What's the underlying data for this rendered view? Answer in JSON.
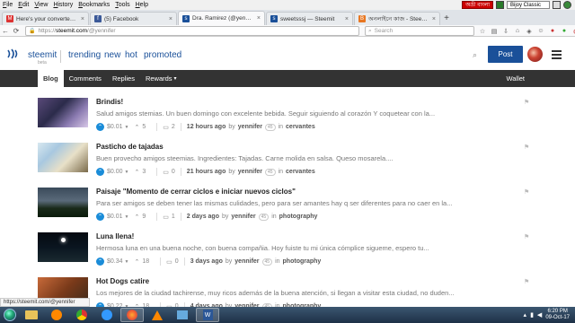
{
  "menubar": {
    "items": [
      {
        "label": "File",
        "u": "F",
        "rest": "ile"
      },
      {
        "label": "Edit",
        "u": "E",
        "rest": "dit"
      },
      {
        "label": "View",
        "u": "V",
        "rest": "iew"
      },
      {
        "label": "History",
        "u": "H",
        "rest": "istory"
      },
      {
        "label": "Bookmarks",
        "u": "B",
        "rest": "ookmarks"
      },
      {
        "label": "Tools",
        "u": "T",
        "rest": "ools"
      },
      {
        "label": "Help",
        "u": "H",
        "rest": "elp"
      }
    ],
    "lang_badge": "অভ্রী বাংলা",
    "keyboard": "Bijoy Classic"
  },
  "tabs": [
    {
      "title": "Here's your converted docu",
      "icon_color": "#d33",
      "icon": "M"
    },
    {
      "title": "(5) Facebook",
      "icon_color": "#3b5998",
      "icon": "f"
    },
    {
      "title": "Dra. Ramirez (@yennifer) —",
      "icon_color": "#1a5099",
      "icon": "s"
    },
    {
      "title": "sweetsssj — Steemit",
      "icon_color": "#1a5099",
      "icon": "s"
    },
    {
      "title": "অনলাইনে কাজ - Steemit Lovers",
      "icon_color": "#e87722",
      "icon": "B"
    }
  ],
  "navbar": {
    "url_prefix": "https://",
    "url_host": "steemit.com",
    "url_path": "/@yennifer",
    "search_placeholder": "Search"
  },
  "header": {
    "brand": "steemit",
    "brand_sub": "beta",
    "nav": [
      "trending",
      "new",
      "hot",
      "promoted"
    ],
    "post_label": "Post"
  },
  "usernav": {
    "items": [
      "Blog",
      "Comments",
      "Replies",
      "Rewards"
    ],
    "rewards_caret": "▾",
    "wallet": "Wallet"
  },
  "posts": [
    {
      "title": "Brindis!",
      "body": "Salud amigos stemias. Un buen domingo con excelente bebida. Seguir siguiendo al corazón Y coquetear con la...",
      "payout": "$0.01",
      "votes": "5",
      "comments": "2",
      "time": "12 hours ago",
      "author": "yennifer",
      "rep": "45",
      "category": "cervantes"
    },
    {
      "title": "Pasticho de tajadas",
      "body": "Buen provecho amigos steemias. Ingredientes: Tajadas. Carne molida en salsa. Queso mosarela....",
      "payout": "$0.00",
      "votes": "3",
      "comments": "0",
      "time": "21 hours ago",
      "author": "yennifer",
      "rep": "45",
      "category": "cervantes"
    },
    {
      "title": "Paisaje \"Momento de cerrar ciclos e iniciar nuevos ciclos\"",
      "body": "Para ser amigos se deben tener las mismas culidades, pero para ser amantes hay q ser diferentes para no caer en la...",
      "payout": "$0.01",
      "votes": "9",
      "comments": "1",
      "time": "2 days ago",
      "author": "yennifer",
      "rep": "45",
      "category": "photography"
    },
    {
      "title": "Luna llena!",
      "body": "Hermosa luna en una buena noche, con buena compañia. Hoy fuiste tu mi única cómplice sigueme, espero tu...",
      "payout": "$0.34",
      "votes": "18",
      "comments": "0",
      "time": "3 days ago",
      "author": "yennifer",
      "rep": "45",
      "category": "photography"
    },
    {
      "title": "Hot Dogs catire",
      "body": "Los mejores de la ciudad tachirense, muy ricos además de la buena atención, si llegan a visitar esta ciudad, no duden...",
      "payout": "$0.22",
      "votes": "18",
      "comments": "0",
      "time": "4 days ago",
      "author": "yennifer",
      "rep": "45",
      "category": "photography"
    }
  ],
  "strings": {
    "by": "by",
    "in": "in"
  },
  "statusbar": "https://steemit.com/@yennifer",
  "taskbar": {
    "time": "6:20 PM",
    "date": "09-Oct-17"
  }
}
